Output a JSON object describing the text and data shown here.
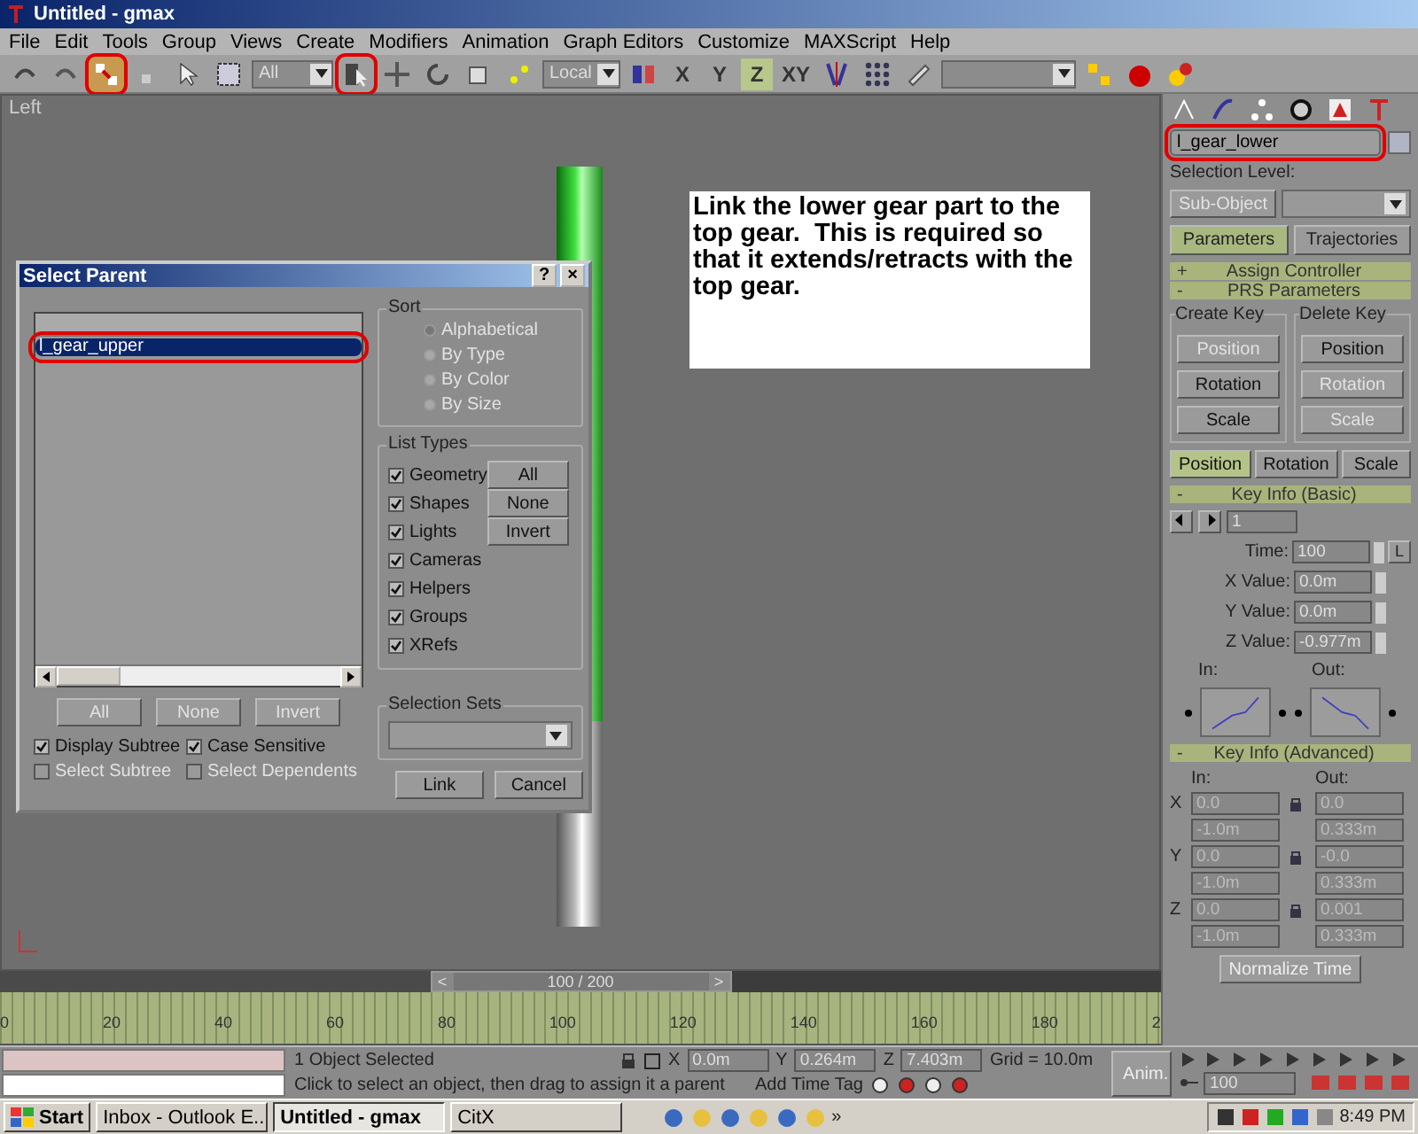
{
  "window": {
    "title": "Untitled - gmax"
  },
  "menu": [
    "File",
    "Edit",
    "Tools",
    "Group",
    "Views",
    "Create",
    "Modifiers",
    "Animation",
    "Graph Editors",
    "Customize",
    "MAXScript",
    "Help"
  ],
  "toolbar": {
    "link_highlighted": true,
    "select_by_name_highlighted": true,
    "selection_filter": "All",
    "reference_coordinates": "Local",
    "axes": [
      {
        "label": "X",
        "selected": false
      },
      {
        "label": "Y",
        "selected": false
      },
      {
        "label": "Z",
        "selected": true
      },
      {
        "label": "XY",
        "selected": false
      }
    ]
  },
  "viewport": {
    "label": "Left"
  },
  "callout": {
    "text": "Link the lower gear part to the top gear.  This is required so that it extends/retracts with the top gear."
  },
  "dialog": {
    "title": "Select Parent",
    "help": "?",
    "close": "×",
    "list": [
      {
        "label": "l_gear_upper",
        "selected": true,
        "highlighted": true
      }
    ],
    "list_buttons": [
      {
        "label": "All",
        "disabled": true
      },
      {
        "label": "None",
        "disabled": true
      },
      {
        "label": "Invert",
        "disabled": true
      }
    ],
    "options": [
      {
        "label": "Display Subtree",
        "checked": true,
        "disabled": false
      },
      {
        "label": "Case Sensitive",
        "checked": true,
        "disabled": false
      },
      {
        "label": "Select Subtree",
        "checked": false,
        "disabled": true
      },
      {
        "label": "Select Dependents",
        "checked": false,
        "disabled": true
      }
    ],
    "sort": {
      "title": "Sort",
      "options": [
        {
          "label": "Alphabetical",
          "selected": true
        },
        {
          "label": "By Type",
          "selected": false
        },
        {
          "label": "By Color",
          "selected": false
        },
        {
          "label": "By Size",
          "selected": false
        }
      ]
    },
    "list_types": {
      "title": "List Types",
      "types": [
        {
          "label": "Geometry",
          "checked": true
        },
        {
          "label": "Shapes",
          "checked": true
        },
        {
          "label": "Lights",
          "checked": true
        },
        {
          "label": "Cameras",
          "checked": true
        },
        {
          "label": "Helpers",
          "checked": true
        },
        {
          "label": "Groups",
          "checked": true
        },
        {
          "label": "XRefs",
          "checked": true
        }
      ],
      "buttons": [
        "All",
        "None",
        "Invert"
      ]
    },
    "selection_sets": {
      "title": "Selection Sets"
    },
    "actions": [
      "Link",
      "Cancel"
    ]
  },
  "command_panel": {
    "object_name": "l_gear_lower",
    "name_highlighted": true,
    "selection_level": "Selection Level:",
    "sub_object": "Sub-Object",
    "tabs": [
      {
        "label": "Parameters",
        "selected": true
      },
      {
        "label": "Trajectories",
        "selected": false
      }
    ],
    "assign_controller": {
      "sign": "+",
      "title": "Assign Controller"
    },
    "prs": {
      "sign": "-",
      "title": "PRS Parameters",
      "create_key": {
        "title": "Create Key",
        "buttons": [
          {
            "label": "Position",
            "disabled": true
          },
          {
            "label": "Rotation",
            "disabled": false
          },
          {
            "label": "Scale",
            "disabled": false
          }
        ]
      },
      "delete_key": {
        "title": "Delete Key",
        "buttons": [
          {
            "label": "Position",
            "disabled": false
          },
          {
            "label": "Rotation",
            "disabled": true
          },
          {
            "label": "Scale",
            "disabled": true
          }
        ]
      },
      "modes": [
        {
          "label": "Position",
          "selected": true
        },
        {
          "label": "Rotation",
          "selected": false
        },
        {
          "label": "Scale",
          "selected": false
        }
      ]
    },
    "key_info_basic": {
      "sign": "-",
      "title": "Key Info (Basic)",
      "key": "1",
      "lock": "L",
      "fields": [
        {
          "label": "Time:",
          "value": "100"
        },
        {
          "label": "X Value:",
          "value": "0.0m"
        },
        {
          "label": "Y Value:",
          "value": "0.0m"
        },
        {
          "label": "Z Value:",
          "value": "-0.977m"
        }
      ],
      "in_label": "In:",
      "out_label": "Out:"
    },
    "key_info_advanced": {
      "sign": "-",
      "title": "Key Info (Advanced)",
      "in_label": "In:",
      "out_label": "Out:",
      "rows": [
        {
          "axis": "X",
          "in": "0.0",
          "in_speed": "-1.0m",
          "out": "0.0",
          "out_speed": "0.333m"
        },
        {
          "axis": "Y",
          "in": "0.0",
          "in_speed": "-1.0m",
          "out": "-0.0",
          "out_speed": "0.333m"
        },
        {
          "axis": "Z",
          "in": "0.0",
          "in_speed": "-1.0m",
          "out": "0.001",
          "out_speed": "0.333m"
        }
      ],
      "normalize": "Normalize Time"
    }
  },
  "timeline": {
    "position": "100 / 200",
    "level": 0.5,
    "prev": "<",
    "next": ">",
    "ticks": [
      "0",
      "20",
      "40",
      "60",
      "80",
      "100",
      "120",
      "140",
      "160",
      "180",
      "2"
    ]
  },
  "status": {
    "selection": "1 Object Selected",
    "prompt": "Click to select an object, then drag to assign it a parent",
    "x_label": "X",
    "x": "0.0m",
    "y_label": "Y",
    "y": "0.264m",
    "z_label": "Z",
    "z": "7.403m",
    "grid": "Grid = 10.0m",
    "time_tag": "Add Time Tag",
    "anim": "Anim.",
    "frame": "100"
  },
  "taskbar": {
    "start": "Start",
    "tasks": [
      {
        "label": "Inbox - Outlook E...",
        "selected": false
      },
      {
        "label": "Untitled - gmax",
        "selected": true
      },
      {
        "label": "CitX",
        "selected": false
      }
    ],
    "more": "»",
    "clock": "8:49 PM"
  }
}
